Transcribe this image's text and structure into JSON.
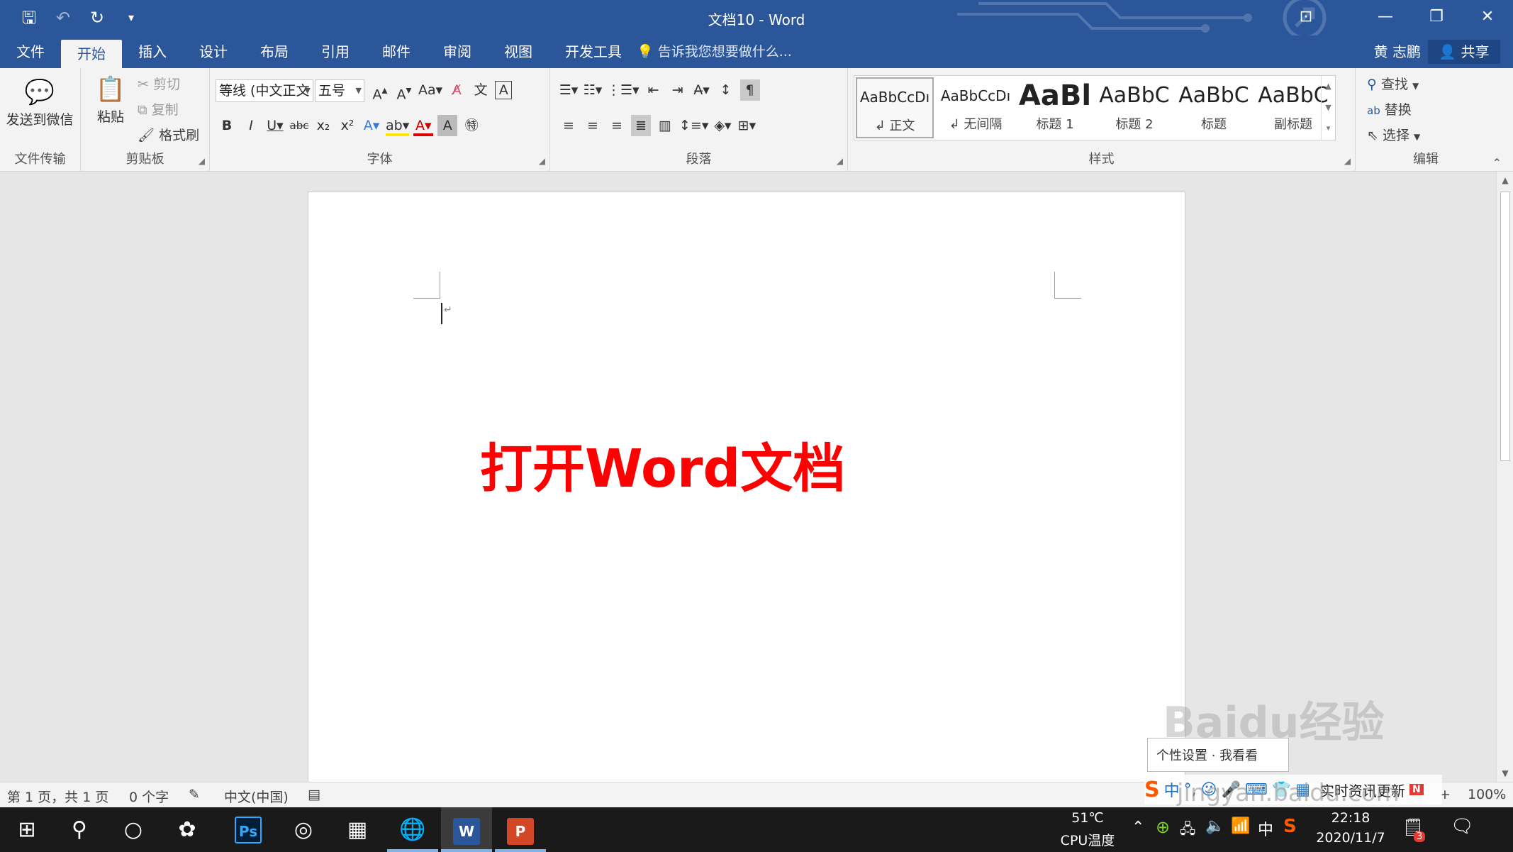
{
  "window": {
    "title": "文档10 - Word"
  },
  "qat": {
    "save": "🖫",
    "undo": "↶",
    "undo_more": "▾",
    "redo": "↻",
    "customize": "▾"
  },
  "window_controls": {
    "ribbon_display": "⊡",
    "minimize": "—",
    "restore": "❐",
    "close": "✕"
  },
  "tabs": [
    "文件",
    "开始",
    "插入",
    "设计",
    "布局",
    "引用",
    "邮件",
    "审阅",
    "视图",
    "开发工具"
  ],
  "tell_me": "告诉我您想要做什么...",
  "user_name": "黄 志鹏",
  "share_label": "共享",
  "ribbon": {
    "wechat_group": {
      "send_label": "发送到微信",
      "group_label": "文件传输"
    },
    "clipboard": {
      "paste": "粘贴",
      "cut": "剪切",
      "copy": "复制",
      "format_painter": "格式刷",
      "group_label": "剪贴板"
    },
    "font": {
      "font_name": "等线 (中文正文",
      "font_size": "五号",
      "group_label": "字体"
    },
    "paragraph": {
      "group_label": "段落"
    },
    "styles": {
      "group_label": "样式",
      "items": [
        {
          "preview": "AaBbCcDı",
          "name": "↲ 正文"
        },
        {
          "preview": "AaBbCcDı",
          "name": "↲ 无间隔"
        },
        {
          "preview": "AaBl",
          "name": "标题 1"
        },
        {
          "preview": "AaBbC",
          "name": "标题 2"
        },
        {
          "preview": "AaBbC",
          "name": "标题"
        },
        {
          "preview": "AaBbC",
          "name": "副标题"
        }
      ]
    },
    "editing": {
      "find": "查找",
      "replace": "替换",
      "select": "选择",
      "group_label": "编辑"
    }
  },
  "document": {
    "headline": "打开Word文档",
    "para_mark": "↵"
  },
  "statusbar": {
    "page": "第 1 页，共 1 页",
    "words": "0 个字",
    "language": "中文(中国)",
    "zoom": "100%"
  },
  "overlays": {
    "popup_text": "个性设置  ·  我看看",
    "news_text": "实时资讯更新",
    "news_badge": "N",
    "watermark": "Baidu经验",
    "watermark_url": "jingyan.baidu.com"
  },
  "taskbar": {
    "apps": [
      "Ps",
      "W",
      "P"
    ],
    "cpu_temp": "51℃",
    "cpu_label": "CPU温度",
    "ime": "中",
    "time": "22:18",
    "date": "2020/11/7",
    "notification_count": "3"
  },
  "colors": {
    "accent": "#2b579a",
    "headline": "#ff0000",
    "ps": "#31a8ff",
    "word": "#2b579a",
    "ppt": "#d24726"
  }
}
